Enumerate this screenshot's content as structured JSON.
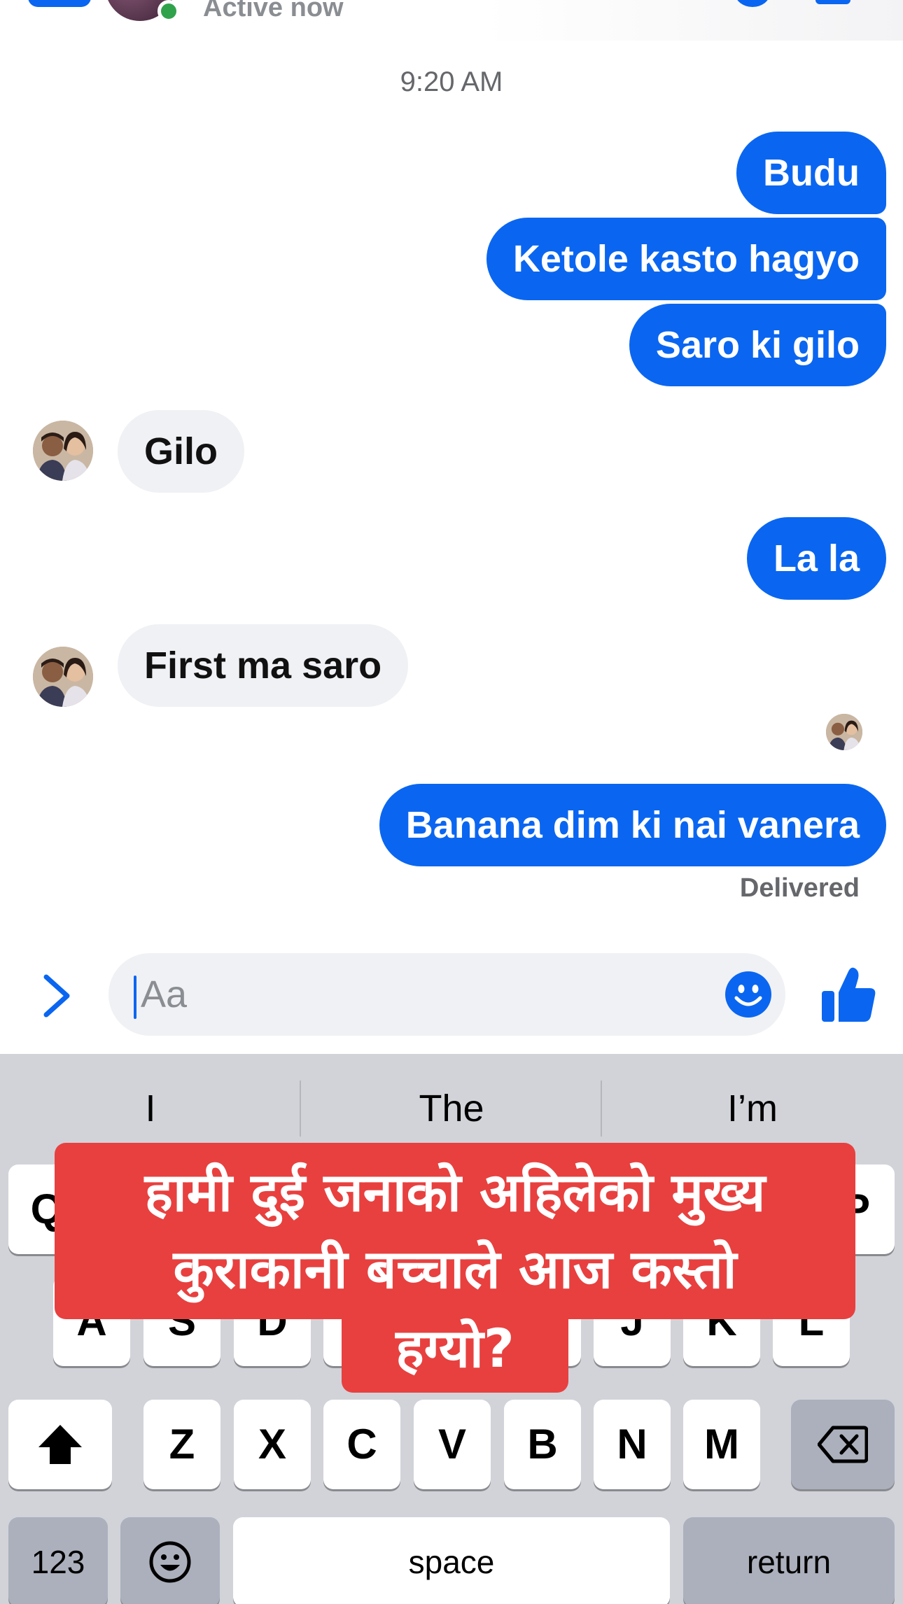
{
  "header": {
    "status": "Active now"
  },
  "thread": {
    "timestamp": "9:20 AM",
    "messages": [
      {
        "from": "me",
        "text": "Budu"
      },
      {
        "from": "me",
        "text": "Ketole kasto hagyo"
      },
      {
        "from": "me",
        "text": "Saro ki gilo"
      },
      {
        "from": "them",
        "text": "Gilo"
      },
      {
        "from": "me",
        "text": "La la"
      },
      {
        "from": "them",
        "text": "First ma saro"
      },
      {
        "from": "me",
        "text": "Banana dim ki nai vanera"
      }
    ],
    "delivered_label": "Delivered"
  },
  "composer": {
    "placeholder": "Aa"
  },
  "keyboard": {
    "suggestions": [
      "I",
      "The",
      "I’m"
    ],
    "row1_visible": [
      "Q",
      "P"
    ],
    "row2_visible": [
      "A",
      "S",
      "D",
      "J",
      "K",
      "L"
    ],
    "row3": [
      "Z",
      "X",
      "C",
      "V",
      "B",
      "N",
      "M"
    ],
    "numbers_label": "123",
    "space_label": "space",
    "return_label": "return"
  },
  "caption": {
    "line1": "हामी दुई जनाको अहिलेको मुख्य",
    "line2": "कुराकानी  बच्चाले आज कस्तो",
    "line3": "हग्यो?"
  },
  "colors": {
    "accent": "#0a66f0",
    "incoming_bubble": "#f0f1f4",
    "caption_bg": "#e8403f",
    "keyboard_bg": "#d1d3d9",
    "online": "#31a24c"
  }
}
